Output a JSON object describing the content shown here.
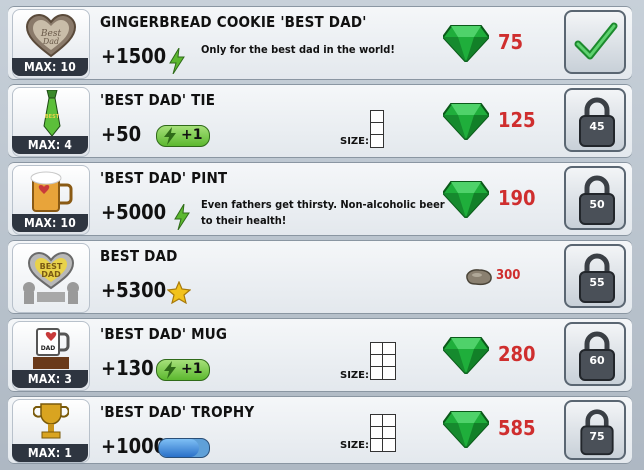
{
  "items": [
    {
      "title": "GINGERBREAD COOKIE 'BEST DAD'",
      "max": "MAX: 10",
      "reward": "+1500",
      "desc": "Only for the best dad in the world!",
      "price": "75",
      "currency": "gem",
      "action": "buy",
      "icon": "gingerbread-heart-cookie"
    },
    {
      "title": "'BEST DAD' TIE",
      "max": "MAX: 4",
      "reward": "+50",
      "energy": "+1",
      "size_label": "SIZE:",
      "price": "125",
      "currency": "gem",
      "lock_level": "45",
      "icon": "tie"
    },
    {
      "title": "'BEST DAD' PINT",
      "max": "MAX: 10",
      "reward": "+5000",
      "desc": "Even fathers get thirsty. Non-alcoholic beer to their health!",
      "price": "190",
      "currency": "gem",
      "lock_level": "50",
      "icon": "beer-pint"
    },
    {
      "title": "BEST DAD",
      "max": "",
      "reward": "+5300",
      "price": "300",
      "currency": "stone",
      "lock_level": "55",
      "icon": "best-dad-heart-statue"
    },
    {
      "title": "'BEST DAD' MUG",
      "max": "MAX: 3",
      "reward": "+130",
      "energy": "+1",
      "size_label": "SIZE:",
      "price": "280",
      "currency": "gem",
      "lock_level": "60",
      "icon": "mug"
    },
    {
      "title": "'BEST DAD' TROPHY",
      "max": "MAX: 1",
      "reward": "+1000",
      "size_label": "SIZE:",
      "price": "585",
      "currency": "gem",
      "lock_level": "75",
      "icon": "trophy"
    }
  ],
  "colors": {
    "price": "#cf2e2e",
    "gem": "#1fae3b",
    "energy": "#5cb82f",
    "xp": "#3a86d6",
    "star": "#f2c21b"
  }
}
